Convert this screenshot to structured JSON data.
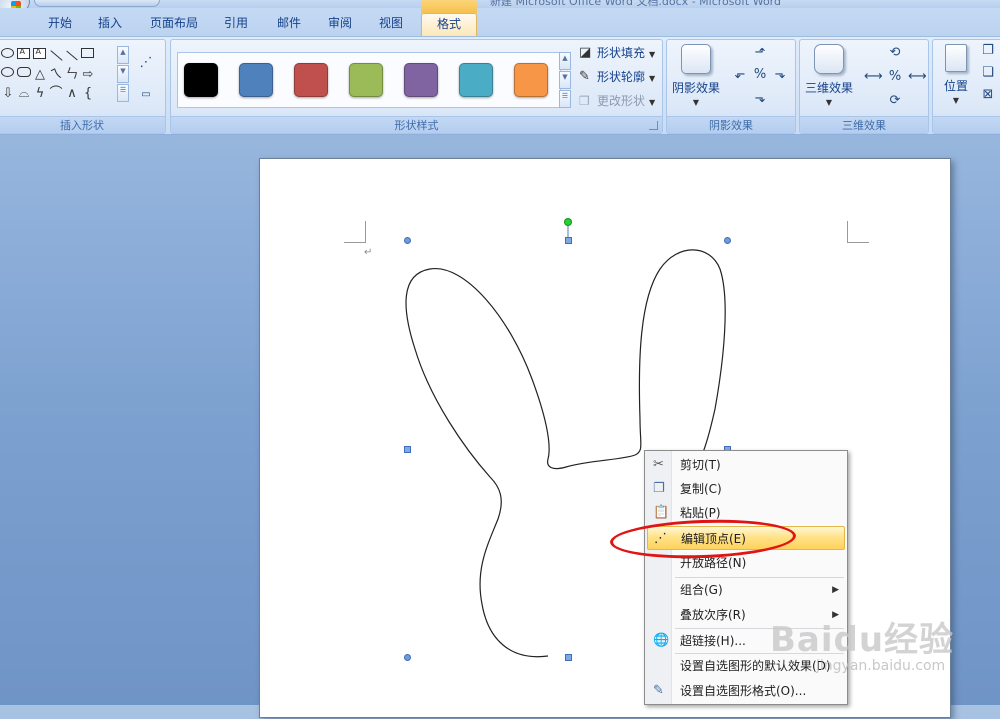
{
  "window": {
    "title": "新建 Microsoft Office Word 文档.docx - Microsoft Word"
  },
  "tabs": [
    {
      "label": "开始",
      "active": false
    },
    {
      "label": "插入",
      "active": false
    },
    {
      "label": "页面布局",
      "active": false
    },
    {
      "label": "引用",
      "active": false
    },
    {
      "label": "邮件",
      "active": false
    },
    {
      "label": "审阅",
      "active": false
    },
    {
      "label": "视图",
      "active": false
    },
    {
      "label": "格式",
      "active": true
    }
  ],
  "ribbon": {
    "insert_shapes": {
      "label": "插入形状"
    },
    "shape_styles": {
      "label": "形状样式",
      "swatches": [
        "#000000",
        "#4f81bd",
        "#c0504d",
        "#9bbb59",
        "#8064a2",
        "#4bacc6",
        "#f79646"
      ],
      "fill": "形状填充",
      "outline": "形状轮廓",
      "change_shape": "更改形状"
    },
    "shadow_effects": {
      "label": "阴影效果",
      "button": "阴影效果"
    },
    "three_d_effects": {
      "label": "三维效果",
      "button": "三维效果"
    },
    "arrange": {
      "position": "位置"
    }
  },
  "context_menu": {
    "items": [
      {
        "label": "剪切(T)",
        "icon": "scissors-icon"
      },
      {
        "label": "复制(C)",
        "icon": "copy-icon"
      },
      {
        "label": "粘贴(P)",
        "icon": "paste-icon"
      },
      {
        "label": "编辑顶点(E)",
        "icon": "edit-points-icon",
        "highlighted": true
      },
      {
        "label": "开放路径(N)",
        "icon": ""
      },
      {
        "label": "组合(G)",
        "icon": "",
        "submenu": true
      },
      {
        "label": "叠放次序(R)",
        "icon": "",
        "submenu": true
      },
      {
        "label": "超链接(H)...",
        "icon": "hyperlink-icon"
      },
      {
        "label": "设置自选图形的默认效果(D)",
        "icon": ""
      },
      {
        "label": "设置自选图形格式(O)...",
        "icon": "format-shape-icon"
      }
    ]
  },
  "watermark": {
    "brand": "Baidu经验",
    "url": "jingyan.baidu.com"
  },
  "colors": {
    "accent_highlight": "#ffd35c",
    "annotation_red": "#e01414"
  }
}
